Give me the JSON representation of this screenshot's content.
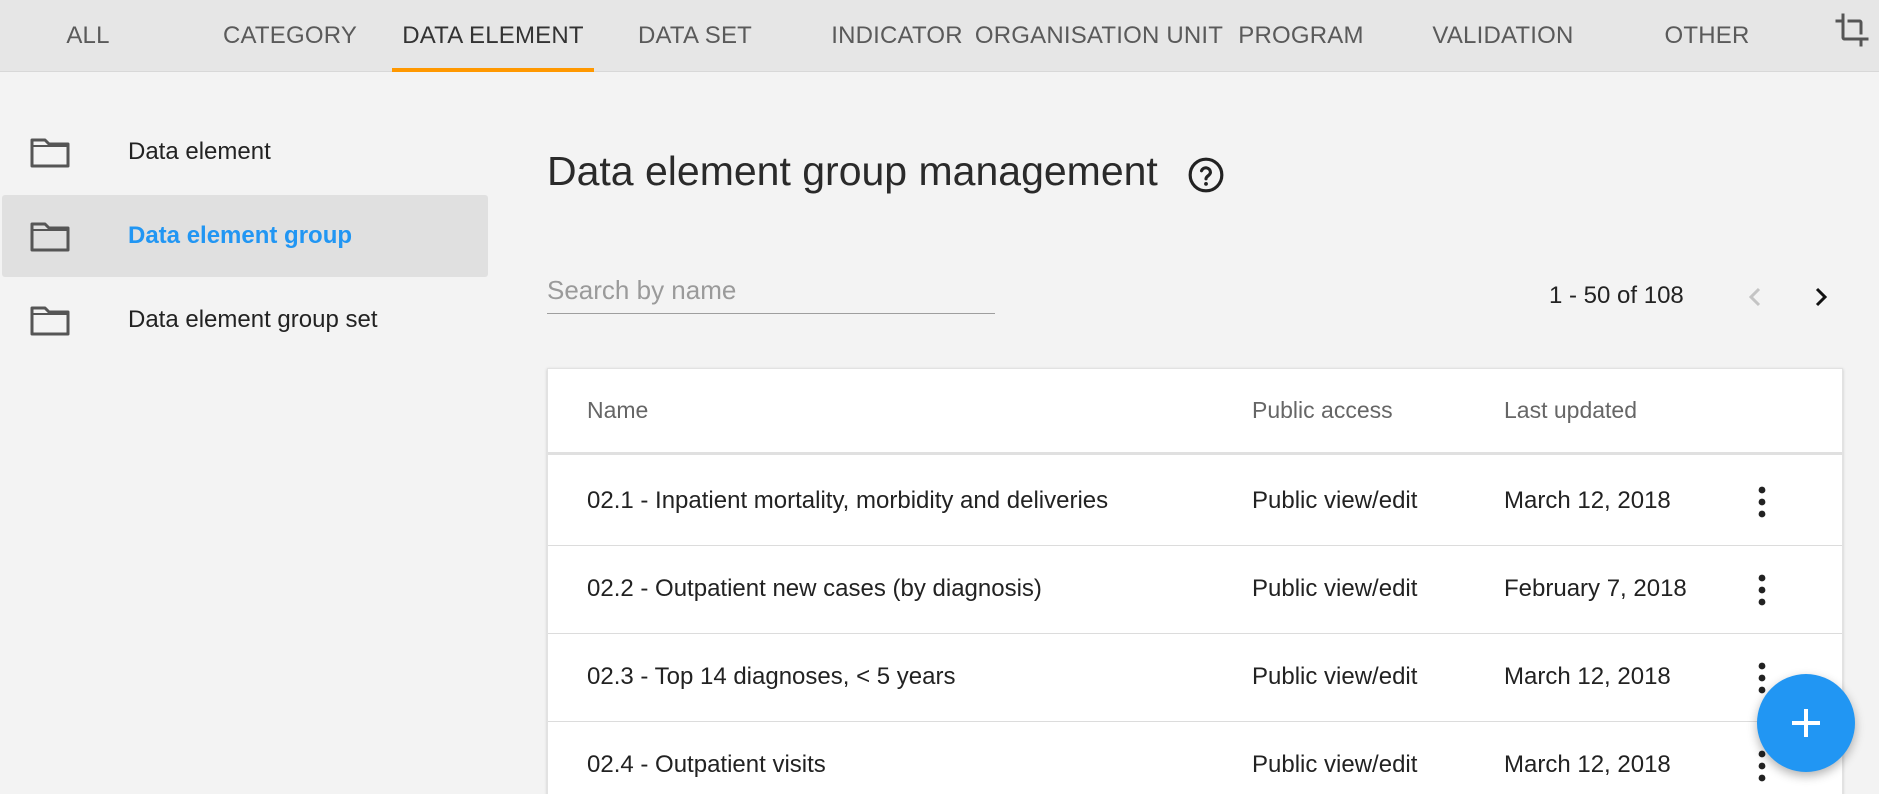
{
  "topbar": {
    "tabs": [
      {
        "label": "ALL"
      },
      {
        "label": "CATEGORY"
      },
      {
        "label": "DATA ELEMENT"
      },
      {
        "label": "DATA SET"
      },
      {
        "label": "INDICATOR"
      },
      {
        "label": "ORGANISATION UNIT"
      },
      {
        "label": "PROGRAM"
      },
      {
        "label": "VALIDATION"
      },
      {
        "label": "OTHER"
      }
    ],
    "active_tab": "DATA ELEMENT",
    "accent_color": "#ff9800",
    "right_icon": "crop-icon"
  },
  "sidebar": {
    "items": [
      {
        "label": "Data element",
        "icon": "folder-icon"
      },
      {
        "label": "Data element group",
        "icon": "folder-icon",
        "active": true
      },
      {
        "label": "Data element group set",
        "icon": "folder-icon"
      }
    ],
    "active_color": "#2196f3"
  },
  "main": {
    "title": "Data element group management",
    "help_icon": "help-circle-icon",
    "search": {
      "placeholder": "Search by name",
      "value": ""
    },
    "pager": {
      "text": "1 - 50 of 108"
    },
    "table": {
      "columns": [
        "Name",
        "Public access",
        "Last updated"
      ],
      "rows": [
        {
          "name": "02.1 - Inpatient mortality, morbidity and deliveries",
          "public_access": "Public view/edit",
          "last_updated": "March 12, 2018"
        },
        {
          "name": "02.2 - Outpatient new cases (by diagnosis)",
          "public_access": "Public view/edit",
          "last_updated": "February 7, 2018"
        },
        {
          "name": "02.3 - Top 14 diagnoses, < 5 years",
          "public_access": "Public view/edit",
          "last_updated": "March 12, 2018"
        },
        {
          "name": "02.4 - Outpatient visits",
          "public_access": "Public view/edit",
          "last_updated": "March 12, 2018"
        }
      ]
    },
    "fab_icon": "plus-icon",
    "fab_color": "#2196f3"
  }
}
